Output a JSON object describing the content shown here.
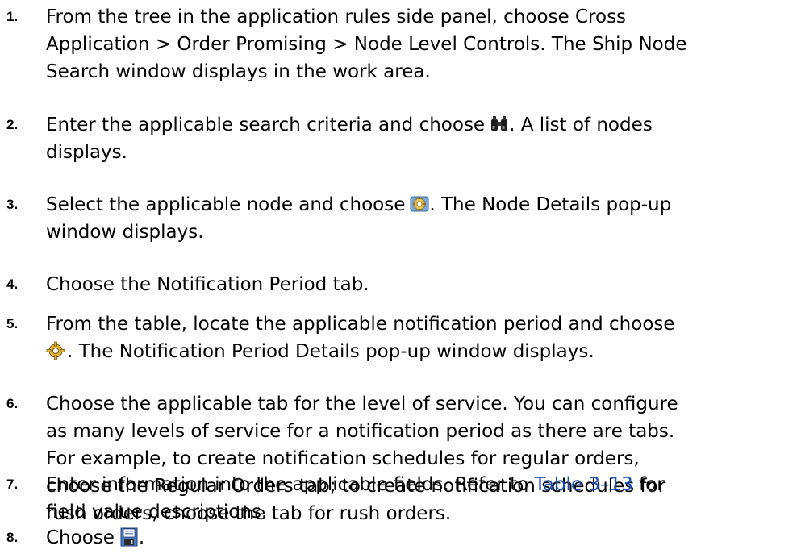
{
  "steps": [
    {
      "number": "1.",
      "lines": [
        "From the tree in the application rules side panel, choose Cross",
        "Application > Order Promising > Node Level Controls. The Ship Node",
        "Search window displays in the work area."
      ]
    },
    {
      "number": "2.",
      "text_before_icon": "Enter the applicable search criteria and choose",
      "icon": "binoculars-icon",
      "text_after_icon": ". A list of nodes",
      "line2": "displays."
    },
    {
      "number": "3.",
      "text_before_icon": "Select the applicable node and choose",
      "icon": "node-details-icon",
      "text_after_icon": ". The Node Details pop-up",
      "line2": "window displays."
    },
    {
      "number": "4.",
      "lines": [
        "Choose the Notification Period tab."
      ]
    },
    {
      "number": "5.",
      "line1": "From the table, locate the applicable notification period and choose",
      "icon": "details-gear-icon",
      "text_after_icon": ". The Notification Period Details pop-up window displays."
    },
    {
      "number": "6.",
      "lines": [
        "Choose the applicable tab for the level of service. You can configure",
        "as many levels of service for a notification period as there are tabs.",
        "For example, to create notification schedules for regular orders,",
        "choose the Regular Orders tab; to create notification schedules for",
        "rush orders, choose the tab for rush orders."
      ]
    },
    {
      "number": "7.",
      "text_before_link": "Enter information into the applicable fields. Refer to ",
      "link_text": "Table 3–13",
      "text_after_link": " for",
      "line2": "field value descriptions."
    },
    {
      "number": "8.",
      "text_before_icon": "Choose",
      "icon": "save-icon",
      "text_after_icon": "."
    }
  ],
  "colors": {
    "link": "#1a4fb5",
    "text": "#000000"
  }
}
